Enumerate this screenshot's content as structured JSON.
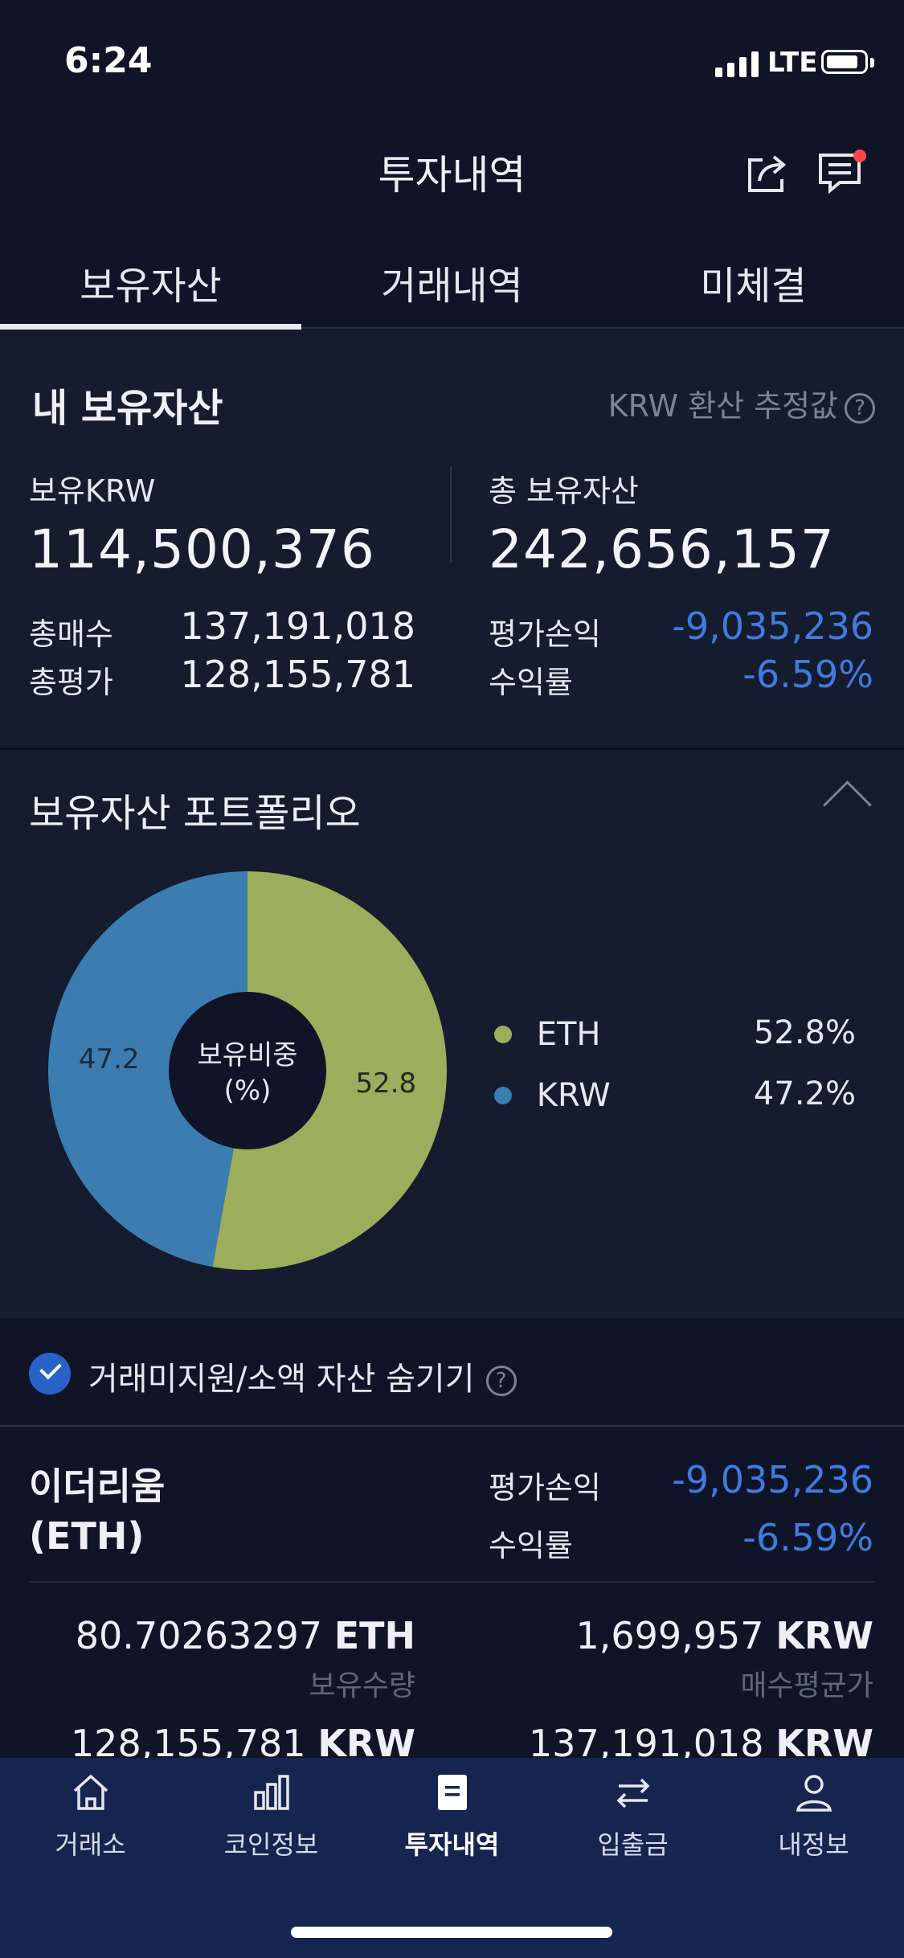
{
  "status_bar": {
    "time": "6:24",
    "network": "LTE"
  },
  "header": {
    "title": "투자내역",
    "icons": [
      "share-icon",
      "chat-icon"
    ]
  },
  "tabs": [
    {
      "label": "보유자산",
      "active": true
    },
    {
      "label": "거래내역",
      "active": false
    },
    {
      "label": "미체결",
      "active": false
    }
  ],
  "summary": {
    "title": "내 보유자산",
    "estimate_label": "KRW 환산 추정값",
    "help": "?",
    "krw_label": "보유KRW",
    "krw_value": "114,500,376",
    "total_label": "총 보유자산",
    "total_value": "242,656,157",
    "buy_label": "총매수",
    "buy_value": "137,191,018",
    "eval_label": "총평가",
    "eval_value": "128,155,781",
    "pl_label": "평가손익",
    "pl_value": "-9,035,236",
    "rate_label": "수익률",
    "rate_value": "-6.59%"
  },
  "portfolio": {
    "title": "보유자산 포트폴리오",
    "center_label_1": "보유비중",
    "center_label_2": "(%)",
    "legend": [
      {
        "name": "ETH",
        "percent": "52.8%",
        "color": "#9bae5c"
      },
      {
        "name": "KRW",
        "percent": "47.2%",
        "color": "#3b7db0"
      }
    ]
  },
  "chart_data": {
    "type": "pie",
    "categories": [
      "ETH",
      "KRW"
    ],
    "values": [
      52.8,
      47.2
    ],
    "labels": [
      "52.8",
      "47.2"
    ],
    "colors": [
      "#9bae5c",
      "#3b7db0"
    ],
    "donut": true
  },
  "hide_option": {
    "label": "거래미지원/소액 자산 숨기기",
    "checked": true,
    "help": "?"
  },
  "coin": {
    "name": "이더리움",
    "symbol": "(ETH)",
    "pl_label": "평가손익",
    "pl_value": "-9,035,236",
    "rate_label": "수익률",
    "rate_value": "-6.59%",
    "qty_value": "80.70263297",
    "qty_unit": "ETH",
    "qty_label": "보유수량",
    "avg_value": "1,699,957",
    "avg_unit": "KRW",
    "avg_label": "매수평균가",
    "eval_value": "128,155,781",
    "eval_unit": "KRW",
    "buy_value": "137,191,018",
    "buy_unit": "KRW"
  },
  "bottom_nav": [
    {
      "label": "거래소",
      "icon": "home-icon",
      "active": false
    },
    {
      "label": "코인정보",
      "icon": "bar-chart-icon",
      "active": false
    },
    {
      "label": "투자내역",
      "icon": "document-icon",
      "active": true
    },
    {
      "label": "입출금",
      "icon": "transfer-icon",
      "active": false
    },
    {
      "label": "내정보",
      "icon": "user-icon",
      "active": false
    }
  ]
}
